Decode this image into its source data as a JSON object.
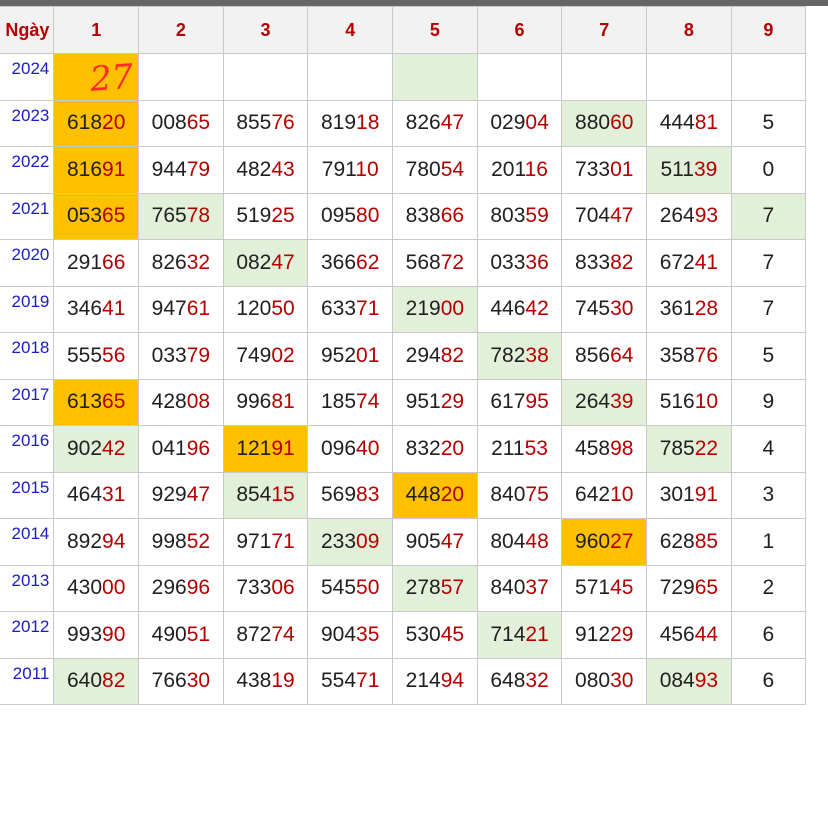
{
  "header": {
    "day_label": "Ngày",
    "columns": [
      "1",
      "2",
      "3",
      "4",
      "5",
      "6",
      "7",
      "8",
      "9"
    ]
  },
  "handwritten_note": "27",
  "colors": {
    "highlight_orange": "#ffc000",
    "highlight_green": "#e2f0d9",
    "header_text": "#b40000",
    "year_text": "#1a1ac8",
    "tail_digits": "#b40000"
  },
  "rows": [
    {
      "year": "2024",
      "cells": [
        {
          "head": "",
          "tail": "",
          "hl": "orange",
          "note": true
        },
        {
          "head": "",
          "tail": ""
        },
        {
          "head": "",
          "tail": ""
        },
        {
          "head": "",
          "tail": ""
        },
        {
          "head": "",
          "tail": "",
          "hl": "green"
        },
        {
          "head": "",
          "tail": ""
        },
        {
          "head": "",
          "tail": ""
        },
        {
          "head": "",
          "tail": ""
        },
        {
          "head": "",
          "tail": ""
        }
      ]
    },
    {
      "year": "2023",
      "cells": [
        {
          "head": "618",
          "tail": "20",
          "hl": "orange"
        },
        {
          "head": "008",
          "tail": "65"
        },
        {
          "head": "855",
          "tail": "76"
        },
        {
          "head": "819",
          "tail": "18"
        },
        {
          "head": "826",
          "tail": "47"
        },
        {
          "head": "029",
          "tail": "04"
        },
        {
          "head": "880",
          "tail": "60",
          "hl": "green"
        },
        {
          "head": "444",
          "tail": "81"
        },
        {
          "head": "5",
          "tail": ""
        }
      ]
    },
    {
      "year": "2022",
      "cells": [
        {
          "head": "816",
          "tail": "91",
          "hl": "orange"
        },
        {
          "head": "944",
          "tail": "79"
        },
        {
          "head": "482",
          "tail": "43"
        },
        {
          "head": "791",
          "tail": "10"
        },
        {
          "head": "780",
          "tail": "54"
        },
        {
          "head": "201",
          "tail": "16"
        },
        {
          "head": "733",
          "tail": "01"
        },
        {
          "head": "511",
          "tail": "39",
          "hl": "green"
        },
        {
          "head": "0",
          "tail": ""
        }
      ]
    },
    {
      "year": "2021",
      "cells": [
        {
          "head": "053",
          "tail": "65",
          "hl": "orange"
        },
        {
          "head": "765",
          "tail": "78",
          "hl": "green"
        },
        {
          "head": "519",
          "tail": "25"
        },
        {
          "head": "095",
          "tail": "80"
        },
        {
          "head": "838",
          "tail": "66"
        },
        {
          "head": "803",
          "tail": "59"
        },
        {
          "head": "704",
          "tail": "47"
        },
        {
          "head": "264",
          "tail": "93"
        },
        {
          "head": "7",
          "tail": "",
          "hl": "green"
        }
      ]
    },
    {
      "year": "2020",
      "cells": [
        {
          "head": "291",
          "tail": "66"
        },
        {
          "head": "826",
          "tail": "32"
        },
        {
          "head": "082",
          "tail": "47",
          "hl": "green"
        },
        {
          "head": "366",
          "tail": "62"
        },
        {
          "head": "568",
          "tail": "72"
        },
        {
          "head": "033",
          "tail": "36"
        },
        {
          "head": "833",
          "tail": "82"
        },
        {
          "head": "672",
          "tail": "41"
        },
        {
          "head": "7",
          "tail": ""
        }
      ]
    },
    {
      "year": "2019",
      "cells": [
        {
          "head": "346",
          "tail": "41"
        },
        {
          "head": "947",
          "tail": "61"
        },
        {
          "head": "120",
          "tail": "50"
        },
        {
          "head": "633",
          "tail": "71"
        },
        {
          "head": "219",
          "tail": "00",
          "hl": "green"
        },
        {
          "head": "446",
          "tail": "42"
        },
        {
          "head": "745",
          "tail": "30"
        },
        {
          "head": "361",
          "tail": "28"
        },
        {
          "head": "7",
          "tail": ""
        }
      ]
    },
    {
      "year": "2018",
      "cells": [
        {
          "head": "555",
          "tail": "56"
        },
        {
          "head": "033",
          "tail": "79"
        },
        {
          "head": "749",
          "tail": "02"
        },
        {
          "head": "952",
          "tail": "01"
        },
        {
          "head": "294",
          "tail": "82"
        },
        {
          "head": "782",
          "tail": "38",
          "hl": "green"
        },
        {
          "head": "856",
          "tail": "64"
        },
        {
          "head": "358",
          "tail": "76"
        },
        {
          "head": "5",
          "tail": ""
        }
      ]
    },
    {
      "year": "2017",
      "cells": [
        {
          "head": "613",
          "tail": "65",
          "hl": "orange"
        },
        {
          "head": "428",
          "tail": "08"
        },
        {
          "head": "996",
          "tail": "81"
        },
        {
          "head": "185",
          "tail": "74"
        },
        {
          "head": "951",
          "tail": "29"
        },
        {
          "head": "617",
          "tail": "95"
        },
        {
          "head": "264",
          "tail": "39",
          "hl": "green"
        },
        {
          "head": "516",
          "tail": "10"
        },
        {
          "head": "9",
          "tail": ""
        }
      ]
    },
    {
      "year": "2016",
      "cells": [
        {
          "head": "902",
          "tail": "42",
          "hl": "green"
        },
        {
          "head": "041",
          "tail": "96"
        },
        {
          "head": "121",
          "tail": "91",
          "hl": "orange"
        },
        {
          "head": "096",
          "tail": "40"
        },
        {
          "head": "832",
          "tail": "20"
        },
        {
          "head": "211",
          "tail": "53"
        },
        {
          "head": "458",
          "tail": "98"
        },
        {
          "head": "785",
          "tail": "22",
          "hl": "green"
        },
        {
          "head": "4",
          "tail": ""
        }
      ]
    },
    {
      "year": "2015",
      "cells": [
        {
          "head": "464",
          "tail": "31"
        },
        {
          "head": "929",
          "tail": "47"
        },
        {
          "head": "854",
          "tail": "15",
          "hl": "green"
        },
        {
          "head": "569",
          "tail": "83"
        },
        {
          "head": "448",
          "tail": "20",
          "hl": "orange"
        },
        {
          "head": "840",
          "tail": "75"
        },
        {
          "head": "642",
          "tail": "10"
        },
        {
          "head": "301",
          "tail": "91"
        },
        {
          "head": "3",
          "tail": ""
        }
      ]
    },
    {
      "year": "2014",
      "cells": [
        {
          "head": "892",
          "tail": "94"
        },
        {
          "head": "998",
          "tail": "52"
        },
        {
          "head": "971",
          "tail": "71"
        },
        {
          "head": "233",
          "tail": "09",
          "hl": "green"
        },
        {
          "head": "905",
          "tail": "47"
        },
        {
          "head": "804",
          "tail": "48"
        },
        {
          "head": "960",
          "tail": "27",
          "hl": "orange"
        },
        {
          "head": "628",
          "tail": "85"
        },
        {
          "head": "1",
          "tail": ""
        }
      ]
    },
    {
      "year": "2013",
      "cells": [
        {
          "head": "430",
          "tail": "00"
        },
        {
          "head": "296",
          "tail": "96"
        },
        {
          "head": "733",
          "tail": "06"
        },
        {
          "head": "545",
          "tail": "50"
        },
        {
          "head": "278",
          "tail": "57",
          "hl": "green"
        },
        {
          "head": "840",
          "tail": "37"
        },
        {
          "head": "571",
          "tail": "45"
        },
        {
          "head": "729",
          "tail": "65"
        },
        {
          "head": "2",
          "tail": ""
        }
      ]
    },
    {
      "year": "2012",
      "cells": [
        {
          "head": "993",
          "tail": "90"
        },
        {
          "head": "490",
          "tail": "51"
        },
        {
          "head": "872",
          "tail": "74"
        },
        {
          "head": "904",
          "tail": "35"
        },
        {
          "head": "530",
          "tail": "45"
        },
        {
          "head": "714",
          "tail": "21",
          "hl": "green"
        },
        {
          "head": "912",
          "tail": "29"
        },
        {
          "head": "456",
          "tail": "44"
        },
        {
          "head": "6",
          "tail": ""
        }
      ]
    },
    {
      "year": "2011",
      "cells": [
        {
          "head": "640",
          "tail": "82",
          "hl": "green"
        },
        {
          "head": "766",
          "tail": "30"
        },
        {
          "head": "438",
          "tail": "19"
        },
        {
          "head": "554",
          "tail": "71"
        },
        {
          "head": "214",
          "tail": "94"
        },
        {
          "head": "648",
          "tail": "32"
        },
        {
          "head": "080",
          "tail": "30"
        },
        {
          "head": "084",
          "tail": "93",
          "hl": "green"
        },
        {
          "head": "6",
          "tail": ""
        }
      ]
    }
  ]
}
